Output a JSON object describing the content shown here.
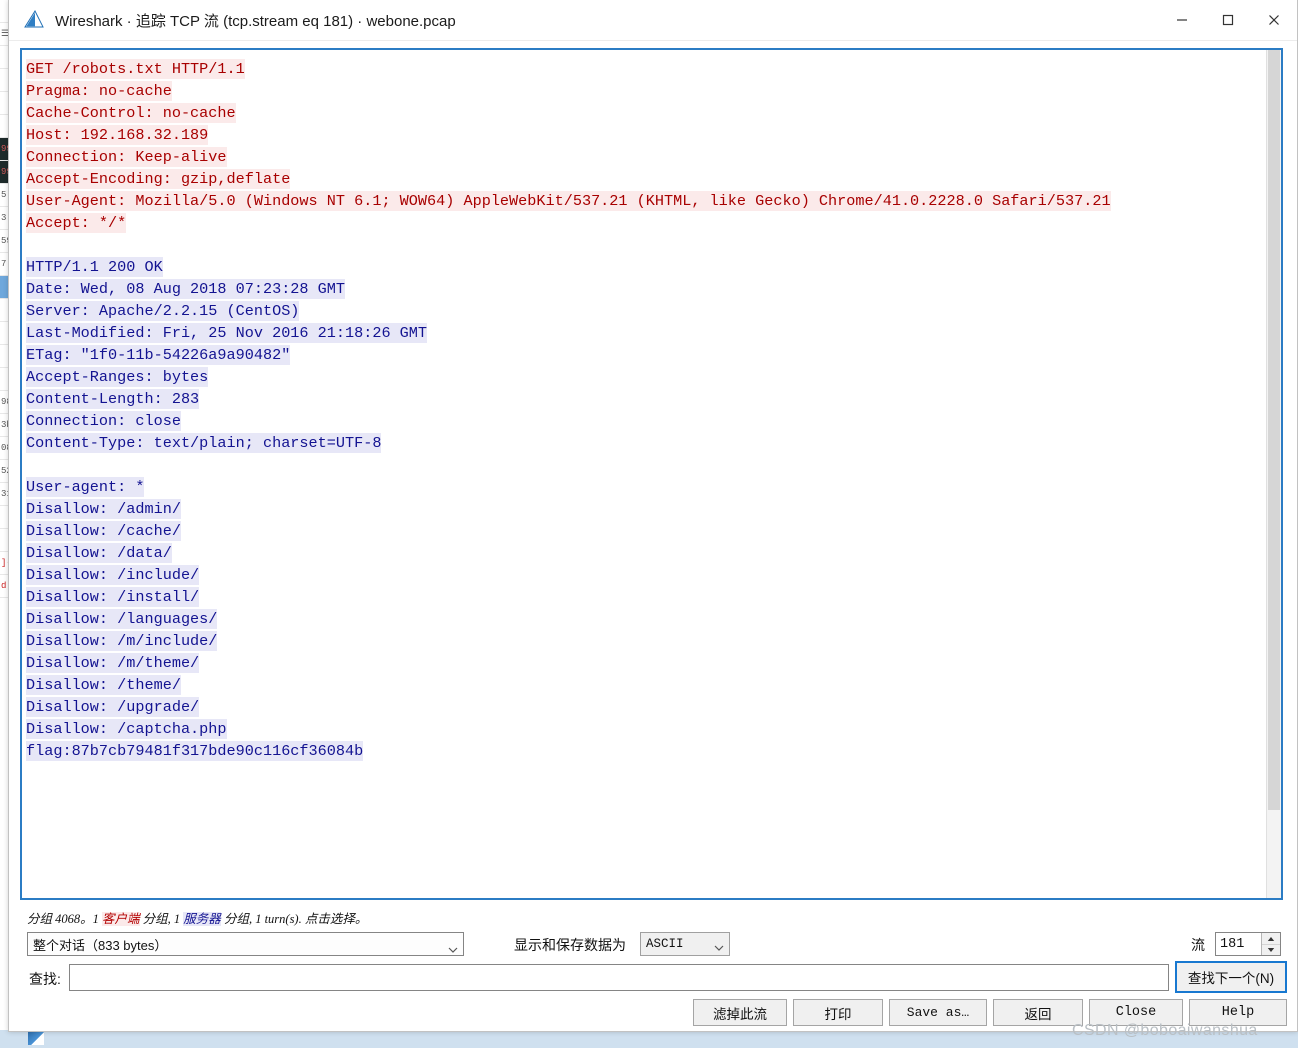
{
  "window": {
    "title": "Wireshark · 追踪 TCP 流 (tcp.stream eq 181) · webone.pcap",
    "icon": "wireshark-fin-icon",
    "minimize_label": "—",
    "maximize_label": "□",
    "close_label": "✕"
  },
  "stream_text": {
    "request_color": "#a80000",
    "request_bg": "#fbeaea",
    "response_color": "#131391",
    "response_bg": "#e7e7f7",
    "lines": [
      {
        "dir": "req",
        "text": "GET /robots.txt HTTP/1.1"
      },
      {
        "dir": "req",
        "text": "Pragma: no-cache"
      },
      {
        "dir": "req",
        "text": "Cache-Control: no-cache"
      },
      {
        "dir": "req",
        "text": "Host: 192.168.32.189"
      },
      {
        "dir": "req",
        "text": "Connection: Keep-alive"
      },
      {
        "dir": "req",
        "text": "Accept-Encoding: gzip,deflate"
      },
      {
        "dir": "req",
        "text": "User-Agent: Mozilla/5.0 (Windows NT 6.1; WOW64) AppleWebKit/537.21 (KHTML, like Gecko) Chrome/41.0.2228.0 Safari/537.21"
      },
      {
        "dir": "req",
        "text": "Accept: */*"
      },
      {
        "dir": "blank",
        "text": ""
      },
      {
        "dir": "resp",
        "text": "HTTP/1.1 200 OK"
      },
      {
        "dir": "resp",
        "text": "Date: Wed, 08 Aug 2018 07:23:28 GMT"
      },
      {
        "dir": "resp",
        "text": "Server: Apache/2.2.15 (CentOS)"
      },
      {
        "dir": "resp",
        "text": "Last-Modified: Fri, 25 Nov 2016 21:18:26 GMT"
      },
      {
        "dir": "resp",
        "text": "ETag: \"1f0-11b-54226a9a90482\""
      },
      {
        "dir": "resp",
        "text": "Accept-Ranges: bytes"
      },
      {
        "dir": "resp",
        "text": "Content-Length: 283"
      },
      {
        "dir": "resp",
        "text": "Connection: close"
      },
      {
        "dir": "resp",
        "text": "Content-Type: text/plain; charset=UTF-8"
      },
      {
        "dir": "blank",
        "text": ""
      },
      {
        "dir": "resp",
        "text": "User-agent: *"
      },
      {
        "dir": "resp",
        "text": "Disallow: /admin/"
      },
      {
        "dir": "resp",
        "text": "Disallow: /cache/"
      },
      {
        "dir": "resp",
        "text": "Disallow: /data/"
      },
      {
        "dir": "resp",
        "text": "Disallow: /include/"
      },
      {
        "dir": "resp",
        "text": "Disallow: /install/"
      },
      {
        "dir": "resp",
        "text": "Disallow: /languages/"
      },
      {
        "dir": "resp",
        "text": "Disallow: /m/include/"
      },
      {
        "dir": "resp",
        "text": "Disallow: /m/theme/"
      },
      {
        "dir": "resp",
        "text": "Disallow: /theme/"
      },
      {
        "dir": "resp",
        "text": "Disallow: /upgrade/"
      },
      {
        "dir": "resp",
        "text": "Disallow: /captcha.php"
      },
      {
        "dir": "resp",
        "text": "flag:87b7cb79481f317bde90c116cf36084b"
      }
    ]
  },
  "status": {
    "prefix": "分组 4068。1 ",
    "client_word": "客户端",
    "middle": " 分组, 1 ",
    "server_word": "服务器",
    "suffix": " 分组, 1 turn(s). 点击选择。"
  },
  "controls": {
    "conversation_value": "整个对话（833 bytes）",
    "show_as_label": "显示和保存数据为",
    "show_as_value": "ASCII",
    "stream_label": "流",
    "stream_value": "181",
    "spin_up": "▲",
    "spin_dn": "▼",
    "caret": "⌄"
  },
  "find": {
    "label": "查找:",
    "value": "",
    "placeholder": "",
    "next_button": "查找下一个(N)"
  },
  "buttons": {
    "filter_out": "滤掉此流",
    "print": "打印",
    "save_as": "Save as…",
    "back": "返回",
    "close": "Close",
    "help": "Help"
  },
  "watermark": "CSDN @boboaiwanshua"
}
